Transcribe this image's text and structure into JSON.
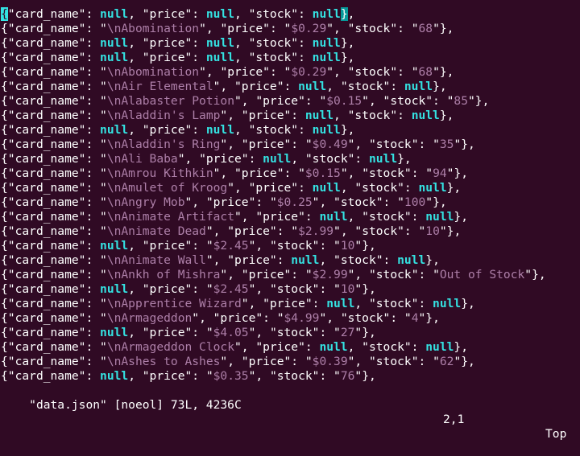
{
  "editor": {
    "theme": {
      "background": "#300a24",
      "text": "#ffffff",
      "null_color": "#34e2e2",
      "string_color": "#ad7fa8",
      "cursor_color": "#34e2e2",
      "match_bracket_color": "#06989a"
    },
    "lines": [
      {
        "card_name": null,
        "price": null,
        "stock": null
      },
      {
        "card_name": "\\nAbomination",
        "price": "$0.29",
        "stock": "68"
      },
      {
        "card_name": null,
        "price": null,
        "stock": null
      },
      {
        "card_name": null,
        "price": null,
        "stock": null
      },
      {
        "card_name": "\\nAbomination",
        "price": "$0.29",
        "stock": "68"
      },
      {
        "card_name": "\\nAir Elemental",
        "price": null,
        "stock": null
      },
      {
        "card_name": "\\nAlabaster Potion",
        "price": "$0.15",
        "stock": "85"
      },
      {
        "card_name": "\\nAladdin's Lamp",
        "price": null,
        "stock": null
      },
      {
        "card_name": null,
        "price": null,
        "stock": null
      },
      {
        "card_name": "\\nAladdin's Ring",
        "price": "$0.49",
        "stock": "35"
      },
      {
        "card_name": "\\nAli Baba",
        "price": null,
        "stock": null
      },
      {
        "card_name": "\\nAmrou Kithkin",
        "price": "$0.15",
        "stock": "94"
      },
      {
        "card_name": "\\nAmulet of Kroog",
        "price": null,
        "stock": null
      },
      {
        "card_name": "\\nAngry Mob",
        "price": "$0.25",
        "stock": "100"
      },
      {
        "card_name": "\\nAnimate Artifact",
        "price": null,
        "stock": null
      },
      {
        "card_name": "\\nAnimate Dead",
        "price": "$2.99",
        "stock": "10"
      },
      {
        "card_name": null,
        "price": "$2.45",
        "stock": "10"
      },
      {
        "card_name": "\\nAnimate Wall",
        "price": null,
        "stock": null
      },
      {
        "card_name": "\\nAnkh of Mishra",
        "price": "$2.99",
        "stock": "Out of Stock"
      },
      {
        "card_name": null,
        "price": "$2.45",
        "stock": "10"
      },
      {
        "card_name": "\\nApprentice Wizard",
        "price": null,
        "stock": null
      },
      {
        "card_name": "\\nArmageddon",
        "price": "$4.99",
        "stock": "4"
      },
      {
        "card_name": null,
        "price": "$4.05",
        "stock": "27"
      },
      {
        "card_name": "\\nArmageddon Clock",
        "price": null,
        "stock": null
      },
      {
        "card_name": "\\nAshes to Ashes",
        "price": "$0.39",
        "stock": "62"
      },
      {
        "card_name": null,
        "price": "$0.35",
        "stock": "76"
      }
    ]
  },
  "status_bar": {
    "file_info": "\"data.json\" [noeol] 73L, 4236C",
    "cursor_position": "2,1",
    "scroll_position": "Top"
  }
}
